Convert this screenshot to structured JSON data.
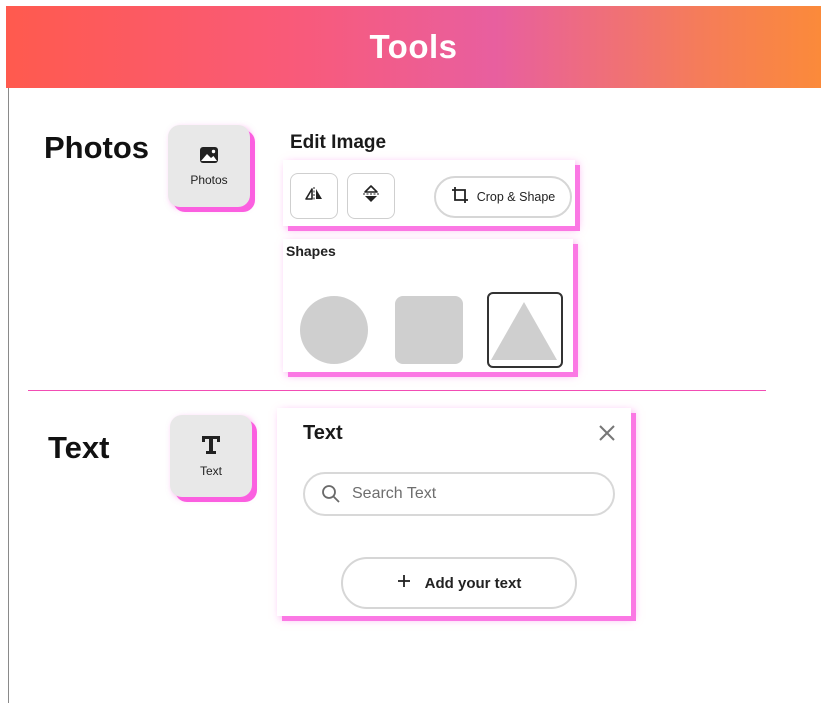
{
  "header": {
    "title": "Tools"
  },
  "photos_section": {
    "label": "Photos",
    "tile": {
      "label": "Photos",
      "icon": "image-icon"
    },
    "edit_image": {
      "title": "Edit Image",
      "flip_horizontal_icon": "flip-horizontal-icon",
      "flip_vertical_icon": "flip-vertical-icon",
      "crop_button_label": "Crop & Shape"
    },
    "shapes": {
      "title": "Shapes",
      "items": [
        "circle",
        "square",
        "triangle"
      ],
      "selected": "triangle"
    }
  },
  "text_section": {
    "label": "Text",
    "tile": {
      "label": "Text",
      "icon": "text-t-icon"
    },
    "panel": {
      "title": "Text",
      "search_placeholder": "Search Text",
      "add_button_label": "Add your text"
    }
  },
  "colors": {
    "accent_pink": "#fb5fe0",
    "shape_fill": "#cfcfcf",
    "tile_bg": "#e8e8e8"
  }
}
